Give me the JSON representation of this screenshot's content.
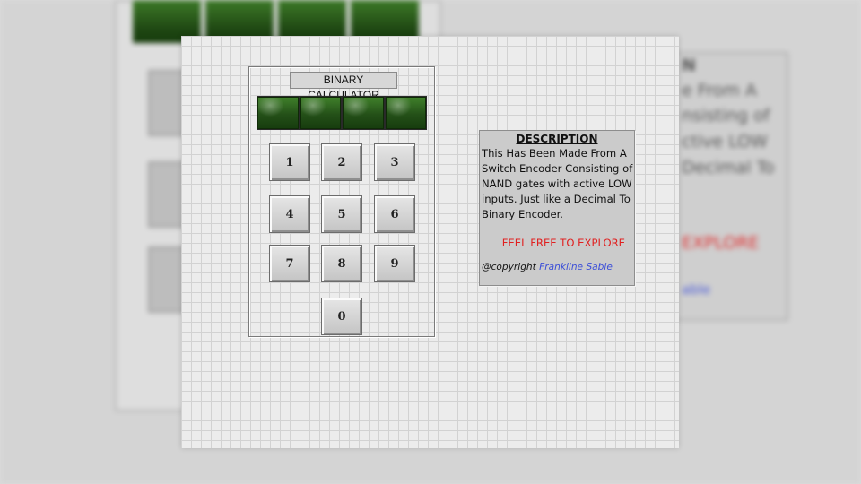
{
  "calculator": {
    "title": "BINARY CALCULATOR",
    "display_leds": 4,
    "keys": [
      "1",
      "2",
      "3",
      "4",
      "5",
      "6",
      "7",
      "8",
      "9",
      "0"
    ]
  },
  "description": {
    "heading": "DESCRIPTION",
    "body": "This Has Been Made From A Switch Encoder Consisting of NAND gates with active LOW inputs. Just like a Decimal To Binary Encoder.",
    "explore": "FEEL FREE TO EXPLORE",
    "copyright_prefix": "@copyright",
    "author": "Frankline Sable"
  },
  "background_text": {
    "line1": "N",
    "line2": "e From A",
    "line3": "nsisting of",
    "line4": "ctive LOW",
    "line5": "Decimal To",
    "line6": "EXPLORE",
    "line7": "able"
  },
  "colors": {
    "led_green": "#245018",
    "explore_red": "#e02020",
    "author_blue": "#3b4ed8"
  }
}
